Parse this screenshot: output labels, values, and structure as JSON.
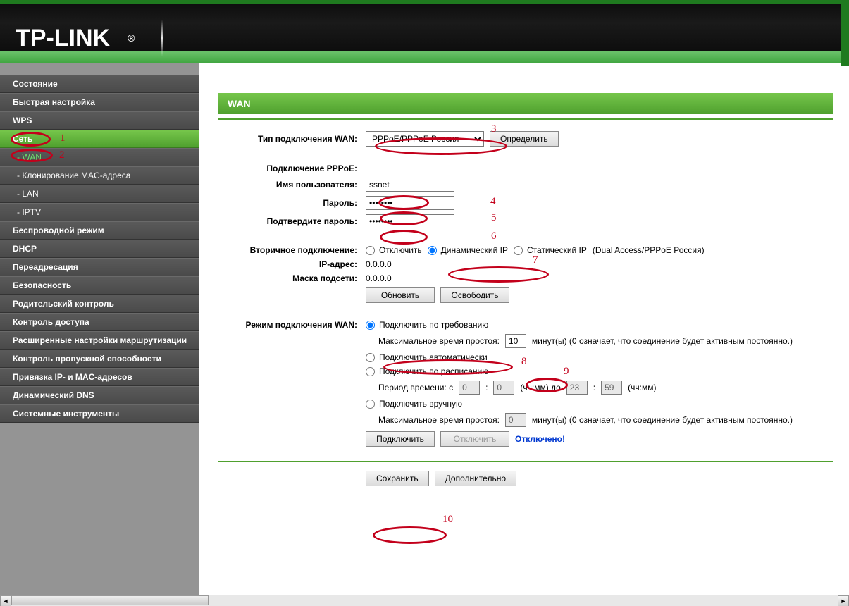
{
  "brand": "TP-LINK",
  "sidebar": {
    "items": [
      {
        "label": "Состояние"
      },
      {
        "label": "Быстрая настройка"
      },
      {
        "label": "WPS"
      },
      {
        "label": "Сеть",
        "active": true
      },
      {
        "label": "- WAN",
        "sub": true,
        "active_sub": true
      },
      {
        "label": "- Клонирование MAC-адреса",
        "sub": true
      },
      {
        "label": "- LAN",
        "sub": true
      },
      {
        "label": "- IPTV",
        "sub": true
      },
      {
        "label": "Беспроводной режим"
      },
      {
        "label": "DHCP"
      },
      {
        "label": "Переадресация"
      },
      {
        "label": "Безопасность"
      },
      {
        "label": "Родительский контроль"
      },
      {
        "label": "Контроль доступа"
      },
      {
        "label": "Расширенные настройки маршрутизации"
      },
      {
        "label": "Контроль пропускной способности"
      },
      {
        "label": "Привязка IP- и MAC-адресов"
      },
      {
        "label": "Динамический DNS"
      },
      {
        "label": "Системные инструменты"
      }
    ]
  },
  "page": {
    "title": "WAN",
    "wan_type_label": "Тип подключения WAN:",
    "wan_type_value": "PPPoE/PPPoE Россия",
    "detect_btn": "Определить",
    "pppoe_header": "Подключение PPPoE:",
    "username_label": "Имя пользователя:",
    "username_value": "ssnet",
    "password_label": "Пароль:",
    "password_value": "********",
    "confirm_label": "Подтвердите пароль:",
    "confirm_value": "********",
    "secondary_label": "Вторичное подключение:",
    "sec_disable": "Отключить",
    "sec_dynamic": "Динамический IP",
    "sec_static": "Статический IP",
    "sec_note": "(Dual Access/PPPoE Россия)",
    "ip_label": "IP-адрес:",
    "ip_value": "0.0.0.0",
    "mask_label": "Маска подсети:",
    "mask_value": "0.0.0.0",
    "update_btn": "Обновить",
    "release_btn": "Освободить",
    "mode_label": "Режим подключения WAN:",
    "mode_demand": "Подключить по требованию",
    "idle_label": "Максимальное время простоя:",
    "idle_value": "10",
    "idle_unit": "минут(ы) (0 означает, что соединение будет активным постоянно.)",
    "mode_auto": "Подключить автоматически",
    "mode_schedule": "Подключить по расписанию",
    "period_prefix": "Период времени:  с",
    "period_h1": "0",
    "period_m1": "0",
    "period_sep": "(чч:мм) до",
    "period_h2": "23",
    "period_m2": "59",
    "period_tail": "(чч:мм)",
    "mode_manual": "Подключить вручную",
    "idle2_value": "0",
    "connect_btn": "Подключить",
    "disconnect_btn": "Отключить",
    "status": "Отключено!",
    "save_btn": "Сохранить",
    "advanced_btn": "Дополнительно"
  },
  "annotations": {
    "n1": "1",
    "n2": "2",
    "n3": "3",
    "n4": "4",
    "n5": "5",
    "n6": "6",
    "n7": "7",
    "n8": "8",
    "n9": "9",
    "n10": "10"
  }
}
